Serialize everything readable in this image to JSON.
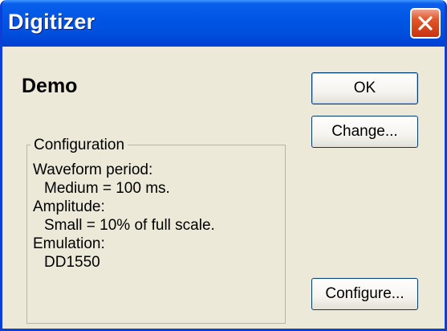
{
  "window": {
    "title": "Digitizer"
  },
  "header": {
    "mode": "Demo"
  },
  "configuration": {
    "label": "Configuration",
    "lines": [
      "Waveform period:",
      "Medium = 100 ms.",
      "Amplitude:",
      "Small = 10% of full scale.",
      "Emulation:",
      "DD1550"
    ]
  },
  "buttons": {
    "ok": "OK",
    "change": "Change...",
    "configure": "Configure..."
  },
  "icons": {
    "close": "close-icon"
  }
}
